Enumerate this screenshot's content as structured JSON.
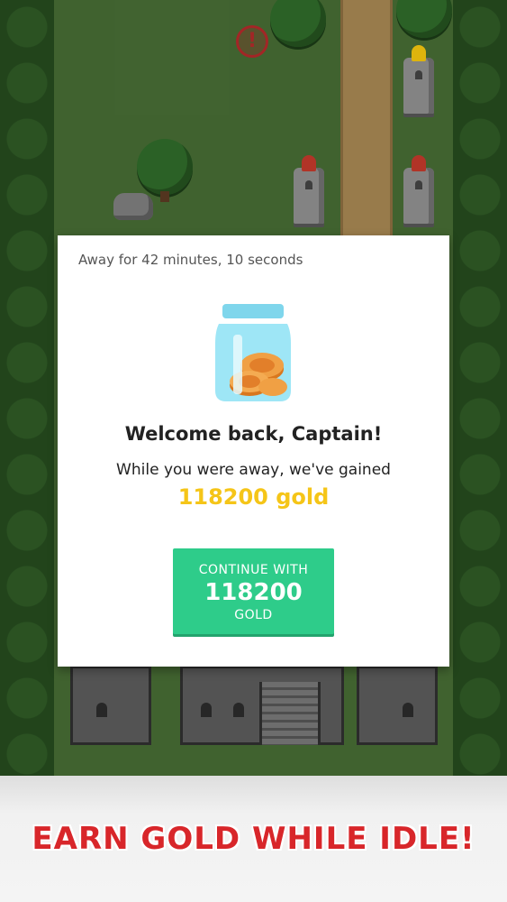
{
  "dialog": {
    "away_text": "Away for 42 minutes, 10 seconds",
    "welcome_text": "Welcome back, Captain!",
    "gained_text": "While you were away, we've gained",
    "gold_amount": "118200 gold",
    "continue_button": {
      "line1": "CONTINUE WITH",
      "line2": "118200",
      "line3": "GOLD"
    },
    "icon": "jar-of-coins-icon"
  },
  "banner": {
    "text": "EARN GOLD WHILE IDLE!"
  },
  "map": {
    "alert_icon": "exclamation-icon"
  },
  "colors": {
    "gold_text": "#f5c518",
    "button_green": "#2ecc8a",
    "banner_red": "#d8262a",
    "tower_red_flame": "#c0392b",
    "tower_yellow_flame": "#f1c40f"
  }
}
